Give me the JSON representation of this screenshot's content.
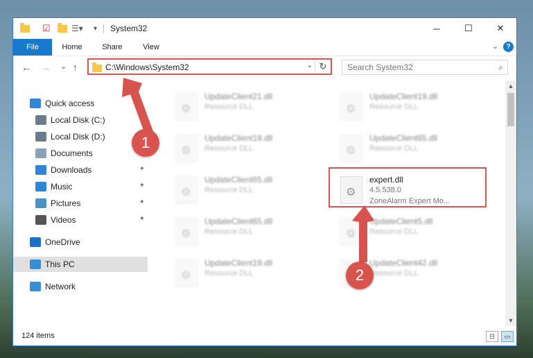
{
  "window": {
    "title": "System32",
    "minimize": "─",
    "maximize": "☐",
    "close": "✕"
  },
  "ribbon": {
    "tabs": [
      "File",
      "Home",
      "Share",
      "View"
    ],
    "help": "?"
  },
  "navigation": {
    "back": "←",
    "forward": "→",
    "recent": "⌄",
    "up": "↑",
    "address": "C:\\Windows\\System32",
    "address_dropdown": "⌄",
    "refresh": "↻",
    "search_placeholder": "Search System32",
    "search_icon": "⌕"
  },
  "sidebar": {
    "items": [
      {
        "label": "Quick access",
        "icon": "star-icon",
        "color": "#2f86d6",
        "pinned": false
      },
      {
        "label": "Local Disk (C:)",
        "icon": "drive-icon",
        "color": "#6b7c8c",
        "pinned": true
      },
      {
        "label": "Local Disk (D:)",
        "icon": "drive-icon",
        "color": "#6b7c8c",
        "pinned": true
      },
      {
        "label": "Documents",
        "icon": "documents-icon",
        "color": "#8aa2b8",
        "pinned": true
      },
      {
        "label": "Downloads",
        "icon": "download-icon",
        "color": "#2f86d6",
        "pinned": true
      },
      {
        "label": "Music",
        "icon": "music-icon",
        "color": "#2f86d6",
        "pinned": true
      },
      {
        "label": "Pictures",
        "icon": "pictures-icon",
        "color": "#4a90c2",
        "pinned": true
      },
      {
        "label": "Videos",
        "icon": "videos-icon",
        "color": "#555555",
        "pinned": true
      },
      {
        "label": "OneDrive",
        "icon": "onedrive-icon",
        "color": "#1e6fc9",
        "pinned": false
      },
      {
        "label": "This PC",
        "icon": "computer-icon",
        "color": "#3b8ed4",
        "pinned": false
      },
      {
        "label": "Network",
        "icon": "network-icon",
        "color": "#3b8ed4",
        "pinned": false
      }
    ],
    "pin_glyph": "📌"
  },
  "files": [
    {
      "name": "UpdateClient21.dll",
      "type": "Resource DLL"
    },
    {
      "name": "UpdateClient19.dll",
      "type": "Resource DLL"
    },
    {
      "name": "UpdateClient19.dll",
      "type": "Resource DLL"
    },
    {
      "name": "UpdateClient65.dll",
      "type": "Resource DLL"
    },
    {
      "name": "UpdateClient65.dll",
      "type": "Resource DLL"
    },
    {
      "name": "expert.dll",
      "version": "4.5.538.0",
      "description": "ZoneAlarm Expert Mo..."
    },
    {
      "name": "UpdateClient65.dll",
      "type": "Resource DLL"
    },
    {
      "name": "UpdateClient5.dll",
      "type": "Resource DLL"
    },
    {
      "name": "UpdateClient19.dll",
      "type": "Resource DLL"
    },
    {
      "name": "UpdateClient42.dll",
      "type": "Resource DLL"
    }
  ],
  "status": {
    "item_count": "124 items"
  },
  "annotations": {
    "step1": "1",
    "step2": "2",
    "color": "#d9534f"
  }
}
